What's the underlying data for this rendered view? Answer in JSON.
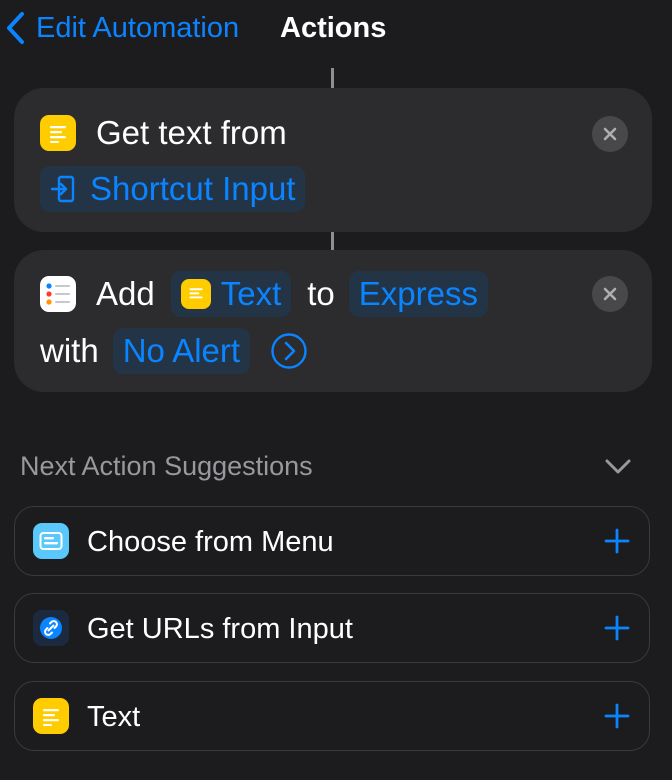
{
  "nav": {
    "back_label": "Edit Automation",
    "title": "Actions"
  },
  "actions": [
    {
      "icon": "text-icon",
      "lead": "Get text from",
      "token_input": "Shortcut Input"
    },
    {
      "icon": "reminders-icon",
      "word_add": "Add",
      "token_text": "Text",
      "word_to": "to",
      "token_list": "Express",
      "word_with": "with",
      "token_alert": "No Alert"
    }
  ],
  "suggestions": {
    "header": "Next Action Suggestions",
    "items": [
      {
        "label": "Choose from Menu",
        "icon": "choose-from-menu-icon"
      },
      {
        "label": "Get URLs from Input",
        "icon": "link-icon"
      },
      {
        "label": "Text",
        "icon": "text-icon"
      }
    ]
  },
  "colors": {
    "background": "#1c1c1e",
    "card": "#2c2c2e",
    "accent": "#0a84ff",
    "token_bg": "#243447",
    "text_icon": "#ffcc00",
    "muted": "#98989d"
  }
}
